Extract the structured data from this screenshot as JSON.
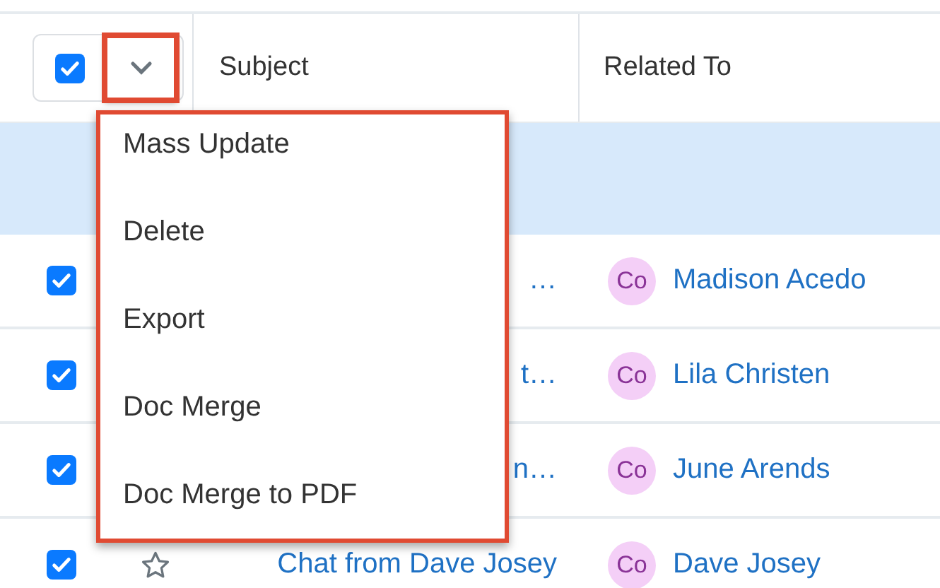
{
  "header": {
    "select_all_checked": true,
    "columns": [
      "Subject",
      "Related To"
    ]
  },
  "rows": [
    {
      "checked": true,
      "subject": "…",
      "related": {
        "avatar": "Co",
        "name": "Madison Acedo"
      }
    },
    {
      "checked": true,
      "subject": "t…",
      "related": {
        "avatar": "Co",
        "name": "Lila Christen"
      }
    },
    {
      "checked": true,
      "subject": "n…",
      "related": {
        "avatar": "Co",
        "name": "June Arends"
      }
    },
    {
      "checked": true,
      "starred": false,
      "subject": "Chat from Dave Josey",
      "related": {
        "avatar": "Co",
        "name": "Dave Josey"
      }
    }
  ],
  "actions_menu": {
    "items": [
      "Mass Update",
      "Delete",
      "Export",
      "Doc Merge",
      "Doc Merge to PDF"
    ]
  }
}
